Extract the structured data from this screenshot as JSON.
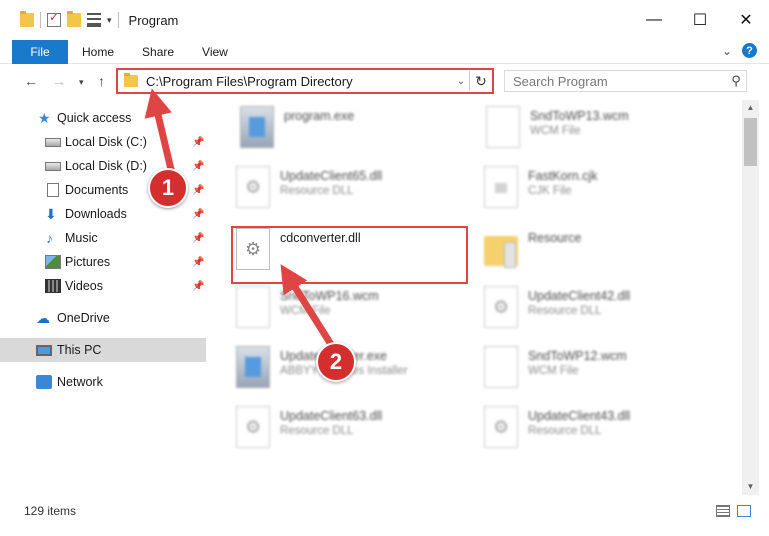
{
  "window": {
    "title": "Program",
    "controls": {
      "minimize": "—",
      "maximize": "☐",
      "close": "✕"
    }
  },
  "ribbon": {
    "tabs": [
      "File",
      "Home",
      "Share",
      "View"
    ]
  },
  "address": {
    "path": "C:\\Program Files\\Program Directory",
    "dropdown_glyph": "⌄",
    "refresh_glyph": "↻"
  },
  "search": {
    "placeholder": "Search Program",
    "icon": "search-icon"
  },
  "sidebar": {
    "items": [
      {
        "label": "Quick access",
        "icon": "star-icon",
        "pinned": false
      },
      {
        "label": "Local Disk (C:)",
        "icon": "disk-icon",
        "pinned": true
      },
      {
        "label": "Local Disk (D:)",
        "icon": "disk-icon",
        "pinned": true
      },
      {
        "label": "Documents",
        "icon": "document-icon",
        "pinned": true
      },
      {
        "label": "Downloads",
        "icon": "download-icon",
        "pinned": true
      },
      {
        "label": "Music",
        "icon": "music-icon",
        "pinned": true
      },
      {
        "label": "Pictures",
        "icon": "pictures-icon",
        "pinned": true
      },
      {
        "label": "Videos",
        "icon": "videos-icon",
        "pinned": true
      },
      {
        "label": "OneDrive",
        "icon": "cloud-icon",
        "pinned": false
      },
      {
        "label": "This PC",
        "icon": "pc-icon",
        "pinned": false,
        "selected": true
      },
      {
        "label": "Network",
        "icon": "network-icon",
        "pinned": false
      }
    ]
  },
  "files": [
    {
      "name": "program.exe",
      "type": "",
      "icon": "exe-icon"
    },
    {
      "name": "SndToWP13.wcm",
      "type": "WCM File",
      "icon": "file-icon"
    },
    {
      "name": "UpdateClient65.dll",
      "type": "Resource DLL",
      "icon": "dll-icon"
    },
    {
      "name": "FastKorn.cjk",
      "type": "CJK File",
      "icon": "file-icon"
    },
    {
      "name": "cdconverter.dll",
      "type": "",
      "icon": "dll-icon",
      "highlighted": true
    },
    {
      "name": "Resource",
      "type": "",
      "icon": "folder-icon"
    },
    {
      "name": "SndToWP16.wcm",
      "type": "WCM File",
      "icon": "file-icon"
    },
    {
      "name": "UpdateClient42.dll",
      "type": "Resource DLL",
      "icon": "dll-icon"
    },
    {
      "name": "UpdateInstaller.exe",
      "type": "ABBYY Updates Installer",
      "icon": "exe-icon"
    },
    {
      "name": "SndToWP12.wcm",
      "type": "WCM File",
      "icon": "file-icon"
    },
    {
      "name": "UpdateClient63.dll",
      "type": "Resource DLL",
      "icon": "dll-icon"
    },
    {
      "name": "UpdateClient43.dll",
      "type": "Resource DLL",
      "icon": "dll-icon"
    }
  ],
  "status": {
    "item_count": "129 items"
  },
  "callouts": [
    {
      "number": "1",
      "color": "#d32f2f"
    },
    {
      "number": "2",
      "color": "#d32f2f"
    }
  ],
  "colors": {
    "accent": "#1979ca",
    "highlight": "#e04545"
  }
}
